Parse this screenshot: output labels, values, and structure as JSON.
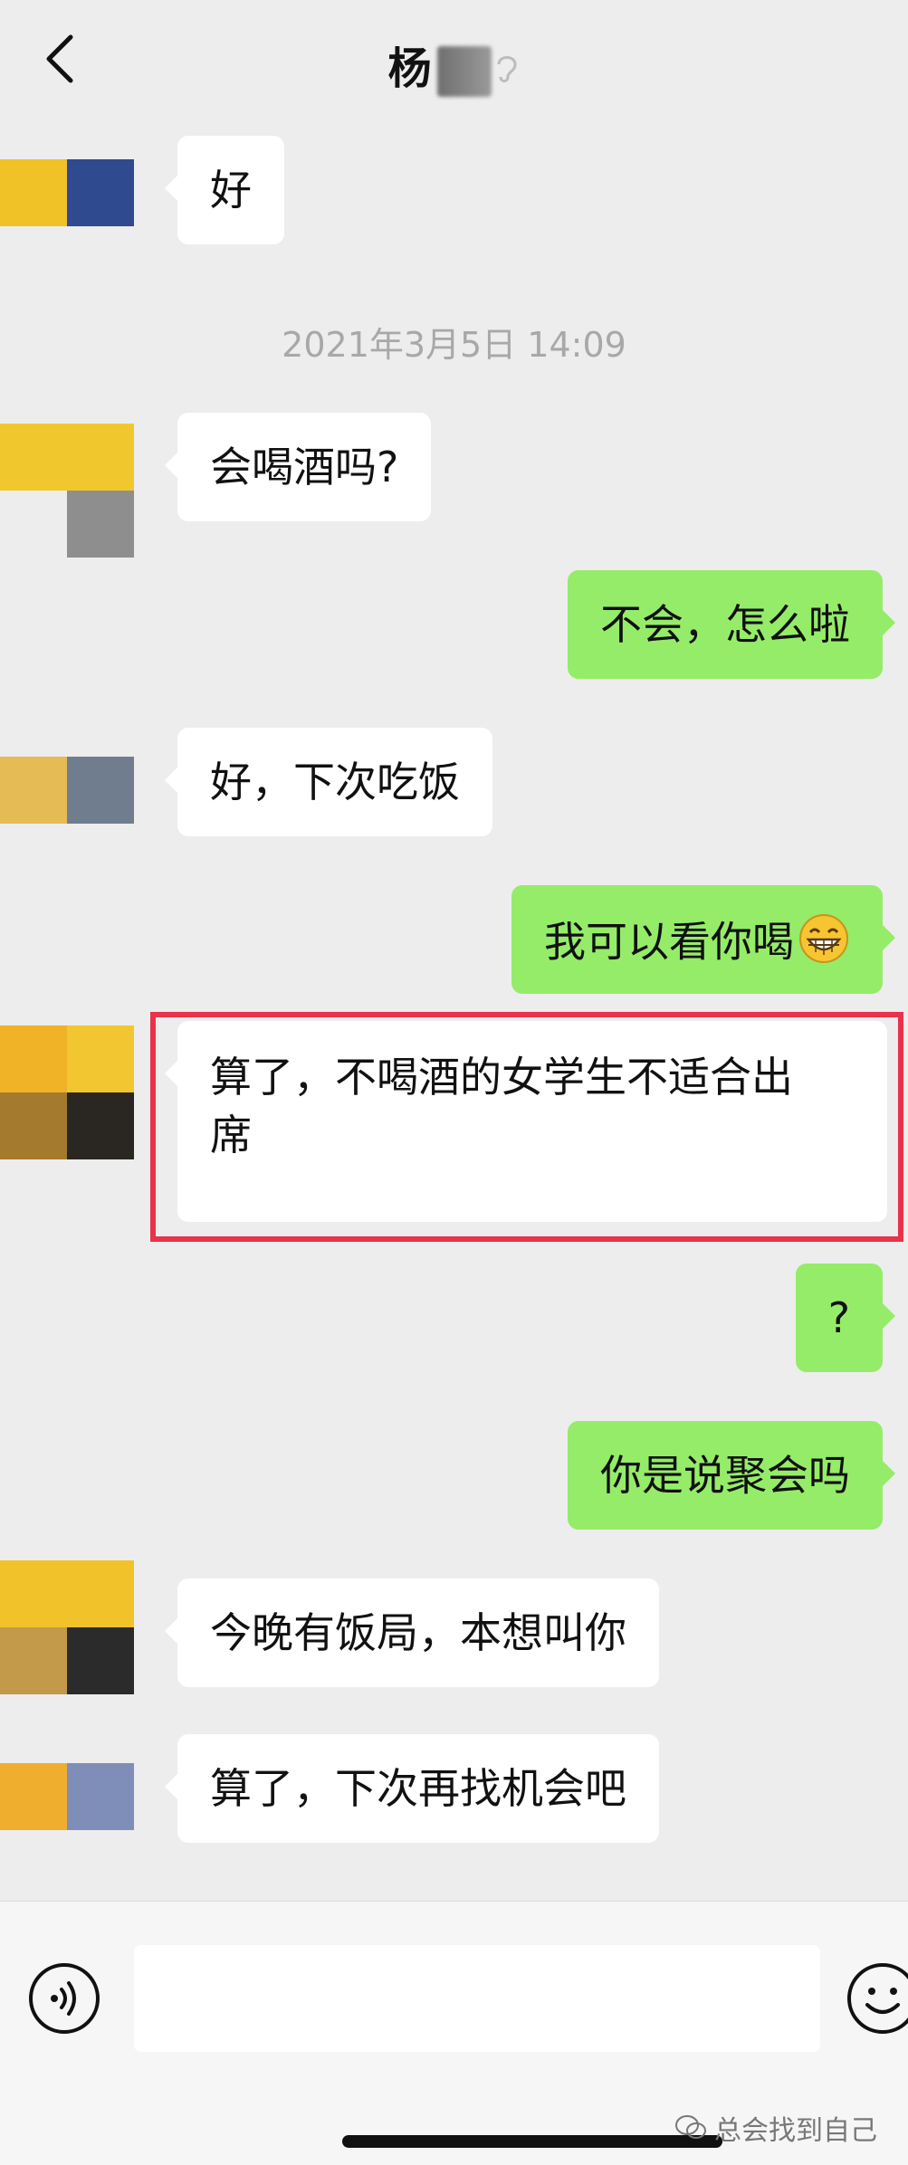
{
  "header": {
    "contact_name": "杨"
  },
  "timestamp": "2021年3月5日 14:09",
  "messages": [
    {
      "side": "in",
      "text": "好"
    },
    {
      "side": "in",
      "text": "会喝酒吗?"
    },
    {
      "side": "out",
      "text": "不会，怎么啦"
    },
    {
      "side": "in",
      "text": "好，下次吃饭"
    },
    {
      "side": "out",
      "text": "我可以看你喝"
    },
    {
      "side": "in",
      "text_line1": "算了，不喝酒的女学生不适合出",
      "text_line2": "席"
    },
    {
      "side": "out",
      "text": "?"
    },
    {
      "side": "out",
      "text": "你是说聚会吗"
    },
    {
      "side": "in",
      "text": "今晚有饭局，本想叫你"
    },
    {
      "side": "in",
      "text": "算了，下次再找机会吧"
    }
  ],
  "watermark": "总会找到自己",
  "colors": {
    "incoming_bubble": "#ffffff",
    "outgoing_bubble": "#95ec69",
    "highlight_border": "#e8334a",
    "background": "#ededed"
  },
  "icons": [
    "back-arrow-icon",
    "ear-icon",
    "grin-emoji-icon",
    "voice-icon",
    "emoji-icon",
    "wechat-icon"
  ]
}
